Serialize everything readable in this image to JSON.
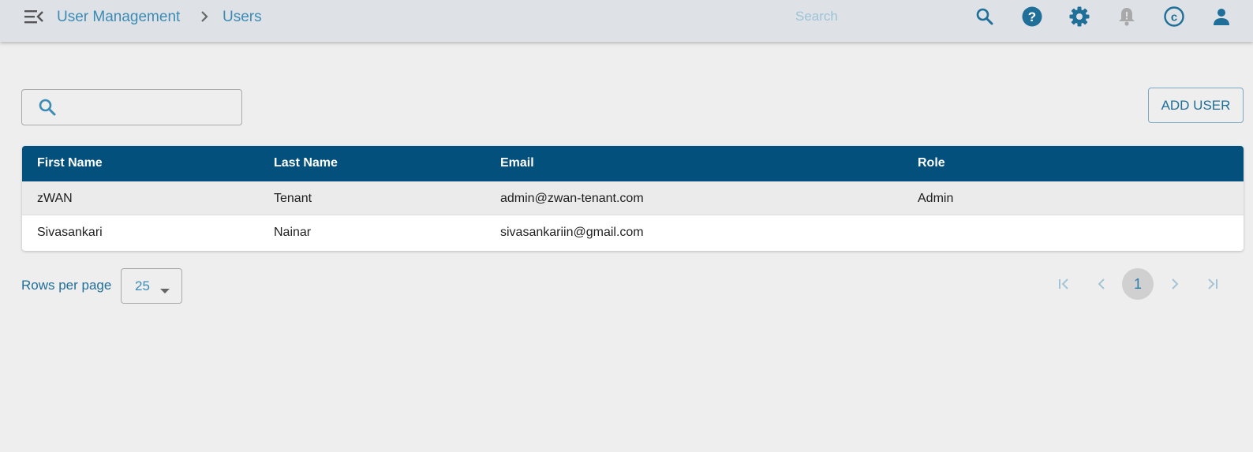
{
  "header": {
    "menu_icon": "menu-collapse-icon",
    "breadcrumb": [
      "User Management",
      "Users"
    ],
    "search_placeholder": "Search",
    "icons": [
      "search-icon",
      "help-icon",
      "settings-icon",
      "notifications-icon",
      "copyright-icon",
      "account-icon"
    ]
  },
  "toolbar": {
    "search_value": "",
    "add_user_label": "ADD USER"
  },
  "table": {
    "columns": [
      "First Name",
      "Last Name",
      "Email",
      "Role"
    ],
    "rows": [
      [
        "zWAN",
        "Tenant",
        "admin@zwan-tenant.com",
        "Admin"
      ],
      [
        "Sivasankari",
        "Nainar",
        "sivasankariin@gmail.com",
        ""
      ]
    ]
  },
  "pagination": {
    "rows_per_page_label": "Rows per page",
    "rows_per_page_value": "25",
    "current_page": "1"
  },
  "colors": {
    "accent": "#3b8bb5",
    "header_bg": "#03507c",
    "topbar_bg": "#dee2e6"
  }
}
